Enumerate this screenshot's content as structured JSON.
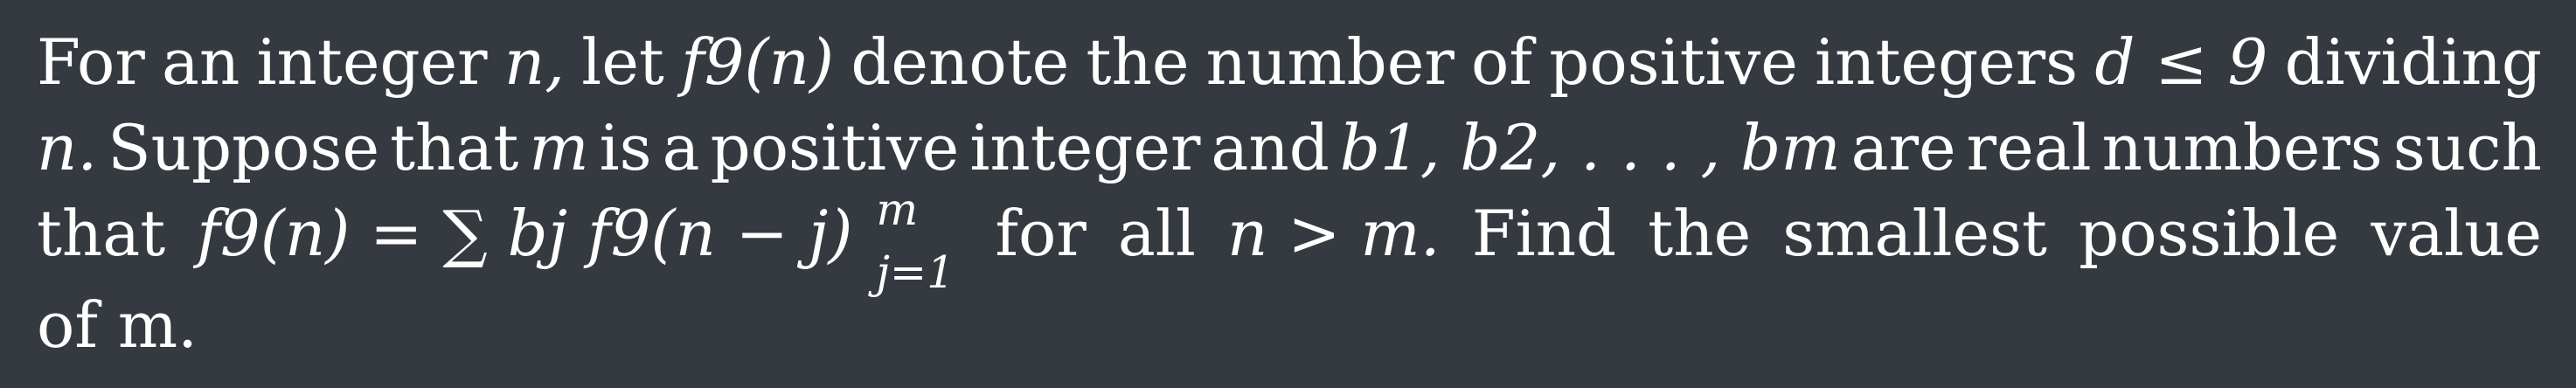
{
  "problem": {
    "line1": [
      "For",
      "an",
      "integer",
      "n,",
      "let",
      "f9(n)",
      "denote",
      "the",
      "number",
      "of",
      "positive",
      "integers",
      "d ≤ 9",
      "dividing"
    ],
    "line2": [
      "n.",
      "Suppose",
      "that",
      "m",
      "is",
      "a",
      "positive",
      "integer",
      "and",
      "b1, b2, . . . , bm",
      "are",
      "real",
      "numbers",
      "such"
    ],
    "line3": [
      "that",
      "f9(n) = ∑ bj f9(n − j)",
      "for",
      "all",
      "n > m.",
      "Find",
      "the",
      "smallest",
      "possible",
      "value"
    ],
    "line4": "of m.",
    "sum_upper": "m",
    "sum_lower": "j=1"
  }
}
